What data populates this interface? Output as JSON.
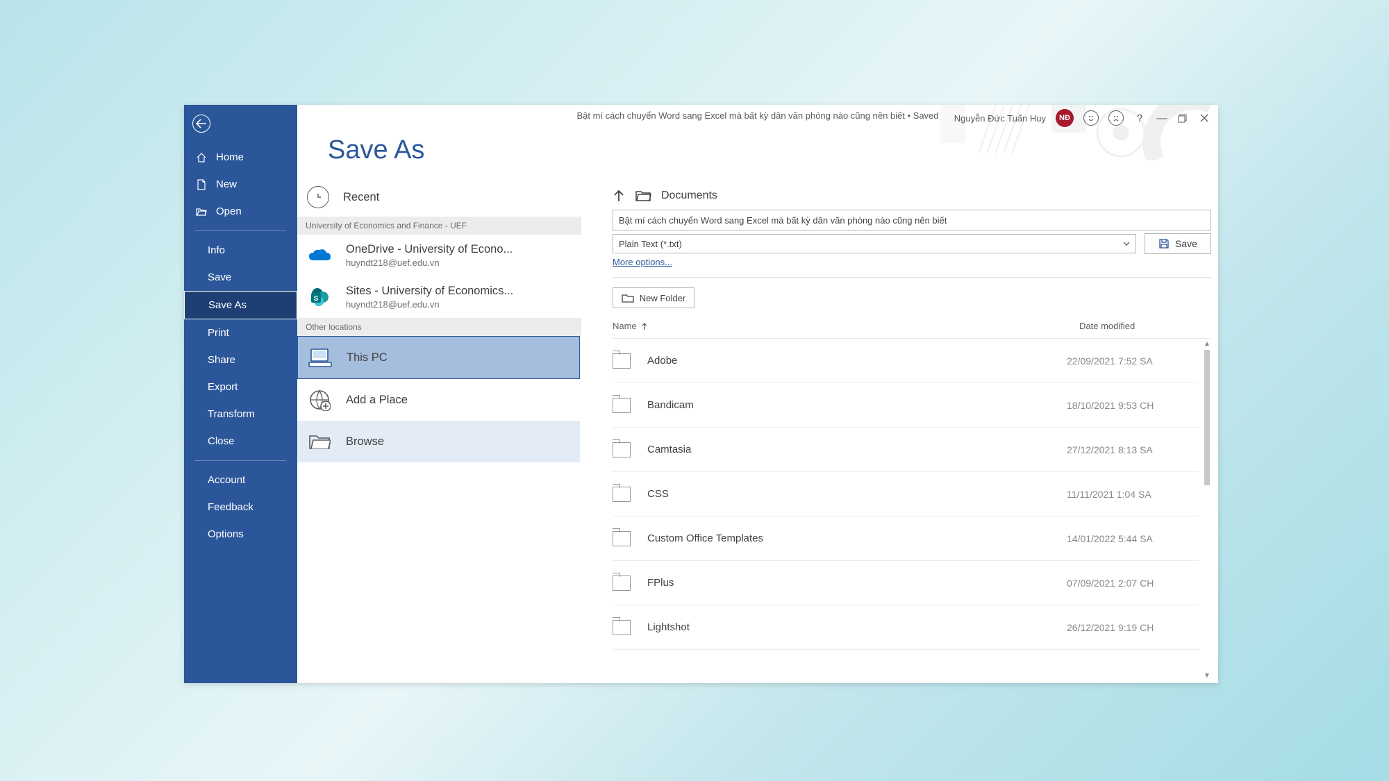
{
  "titlebar": {
    "document_status": "Bật mí cách chuyển Word sang Excel mà bất kỳ dân văn phòng nào cũng nên biết • Saved",
    "user_name": "Nguyễn Đức Tuấn Huy",
    "avatar_initials": "NĐ"
  },
  "page_title": "Save As",
  "sidebar": {
    "home": "Home",
    "new": "New",
    "open": "Open",
    "info": "Info",
    "save": "Save",
    "save_as": "Save As",
    "print": "Print",
    "share": "Share",
    "export": "Export",
    "transform": "Transform",
    "close": "Close",
    "account": "Account",
    "feedback": "Feedback",
    "options": "Options"
  },
  "locations": {
    "recent": "Recent",
    "section_uef": "University of Economics and Finance - UEF",
    "onedrive_label": "OneDrive - University of Econo...",
    "onedrive_sub": "huyndt218@uef.edu.vn",
    "sites_label": "Sites - University of Economics...",
    "sites_sub": "huyndt218@uef.edu.vn",
    "section_other": "Other locations",
    "this_pc": "This PC",
    "add_place": "Add a Place",
    "browse": "Browse"
  },
  "browser": {
    "crumb": "Documents",
    "filename": "Bật mí cách chuyển Word sang Excel mà bất kỳ dân văn phòng nào cũng nên biết",
    "filetype": "Plain Text (*.txt)",
    "more_options": "More options...",
    "save_button": "Save",
    "new_folder": "New Folder",
    "col_name": "Name",
    "col_date": "Date modified",
    "files": [
      {
        "name": "Adobe",
        "date": "22/09/2021 7:52 SA"
      },
      {
        "name": "Bandicam",
        "date": "18/10/2021 9:53 CH"
      },
      {
        "name": "Camtasia",
        "date": "27/12/2021 8:13 SA"
      },
      {
        "name": "CSS",
        "date": "11/11/2021 1:04 SA"
      },
      {
        "name": "Custom Office Templates",
        "date": "14/01/2022 5:44 SA"
      },
      {
        "name": "FPlus",
        "date": "07/09/2021 2:07 CH"
      },
      {
        "name": "Lightshot",
        "date": "26/12/2021 9:19 CH"
      }
    ]
  }
}
